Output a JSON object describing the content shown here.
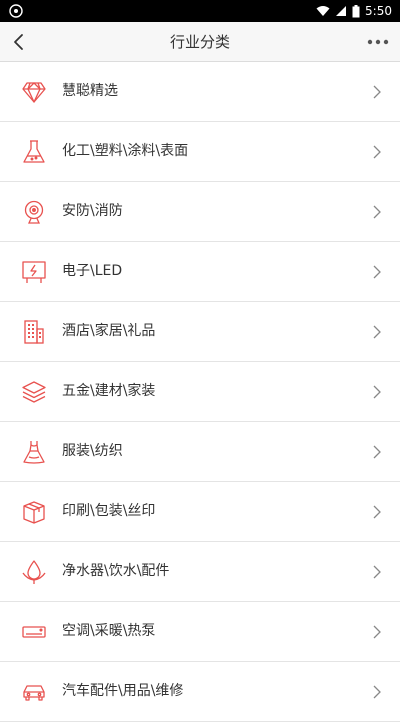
{
  "status_bar": {
    "time": "5:50"
  },
  "header": {
    "title": "行业分类"
  },
  "accent_color": "#e8524f",
  "categories": [
    {
      "label": "慧聪精选",
      "icon": "diamond-icon"
    },
    {
      "label": "化工\\塑料\\涂料\\表面",
      "icon": "flask-icon"
    },
    {
      "label": "安防\\消防",
      "icon": "webcam-icon"
    },
    {
      "label": "电子\\LED",
      "icon": "electronic-board-icon"
    },
    {
      "label": "酒店\\家居\\礼品",
      "icon": "building-icon"
    },
    {
      "label": "五金\\建材\\家装",
      "icon": "layers-icon"
    },
    {
      "label": "服装\\纺织",
      "icon": "dress-icon"
    },
    {
      "label": "印刷\\包装\\丝印",
      "icon": "package-box-icon"
    },
    {
      "label": "净水器\\饮水\\配件",
      "icon": "water-drop-icon"
    },
    {
      "label": "空调\\采暖\\热泵",
      "icon": "air-conditioner-icon"
    },
    {
      "label": "汽车配件\\用品\\维修",
      "icon": "car-icon"
    }
  ]
}
